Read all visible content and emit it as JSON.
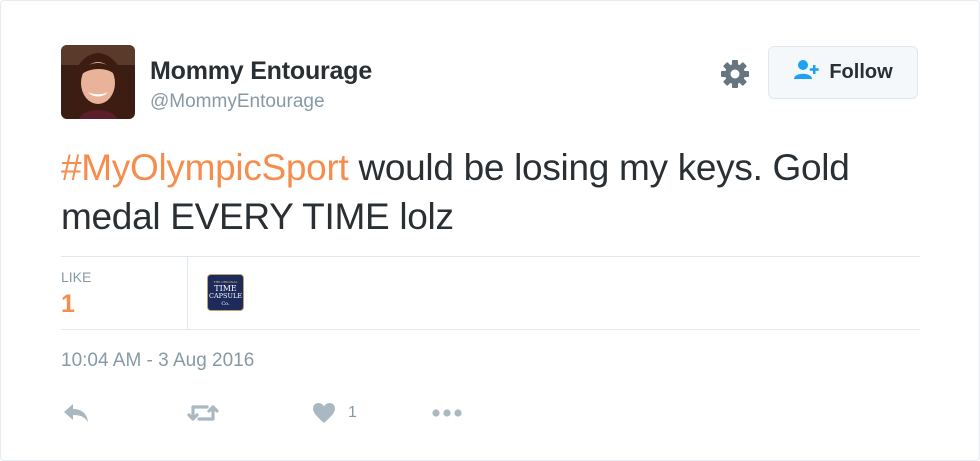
{
  "user": {
    "display_name": "Mommy Entourage",
    "handle": "@MommyEntourage"
  },
  "follow_button": {
    "label": "Follow"
  },
  "tweet": {
    "hashtag": "#MyOlympicSport",
    "text_rest": " would be losing my keys. Gold medal EVERY TIME lolz"
  },
  "stats": {
    "like_label": "LIKE",
    "like_count": "1"
  },
  "liker_avatar": {
    "logo_lines": [
      "THE ORIGINAL",
      "TIME",
      "CAPSULE",
      "Co."
    ]
  },
  "timestamp": "10:04 AM - 3 Aug 2016",
  "actions": {
    "reply_icon": "reply-icon",
    "retweet_icon": "retweet-icon",
    "like_icon": "heart-icon",
    "like_count": "1",
    "more_icon": "more-icon"
  },
  "colors": {
    "accent": "#f58d4d",
    "text": "#292f33",
    "muted": "#8899a6",
    "follow_icon": "#1da1f2"
  }
}
